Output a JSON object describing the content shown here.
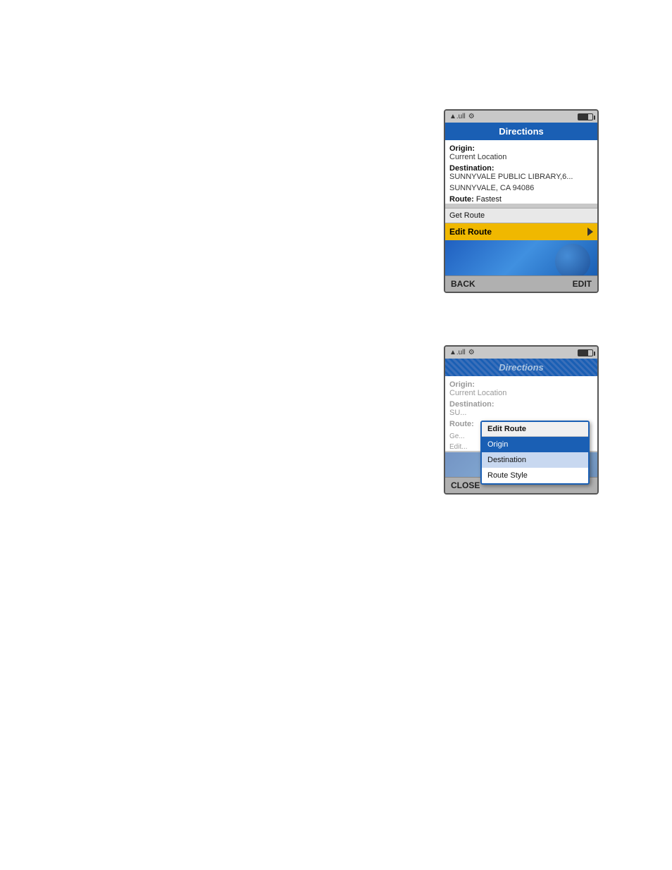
{
  "panel1": {
    "status": {
      "signal": "▲.ull",
      "gear_icon": "⚙",
      "battery_label": "battery"
    },
    "title": "Directions",
    "origin_label": "Origin:",
    "origin_value": "Current Location",
    "destination_label": "Destination:",
    "destination_value": "SUNNYVALE PUBLIC LIBRARY,6...",
    "destination_city": "SUNNYVALE, CA 94086",
    "route_label": "Route:",
    "route_value": "Fastest",
    "get_route": "Get Route",
    "edit_route": "Edit Route",
    "back_label": "BACK",
    "edit_label": "EDIT"
  },
  "panel2": {
    "status": {
      "signal": "▲.ull",
      "gear_icon": "⚙",
      "battery_label": "battery"
    },
    "title": "Directions",
    "origin_label": "Origin:",
    "origin_value": "Current Location",
    "destination_label": "Destination:",
    "destination_value": "SU...",
    "destination_city": "SU...",
    "route_label": "Route:",
    "route_value": "",
    "get_route": "Ge...",
    "edit_route": "Edit...",
    "close_label": "CLOSE",
    "dropdown": {
      "header": "Edit Route",
      "items": [
        {
          "label": "Origin",
          "state": "selected"
        },
        {
          "label": "Destination",
          "state": "hovered"
        },
        {
          "label": "Route Style",
          "state": "normal"
        }
      ]
    }
  }
}
